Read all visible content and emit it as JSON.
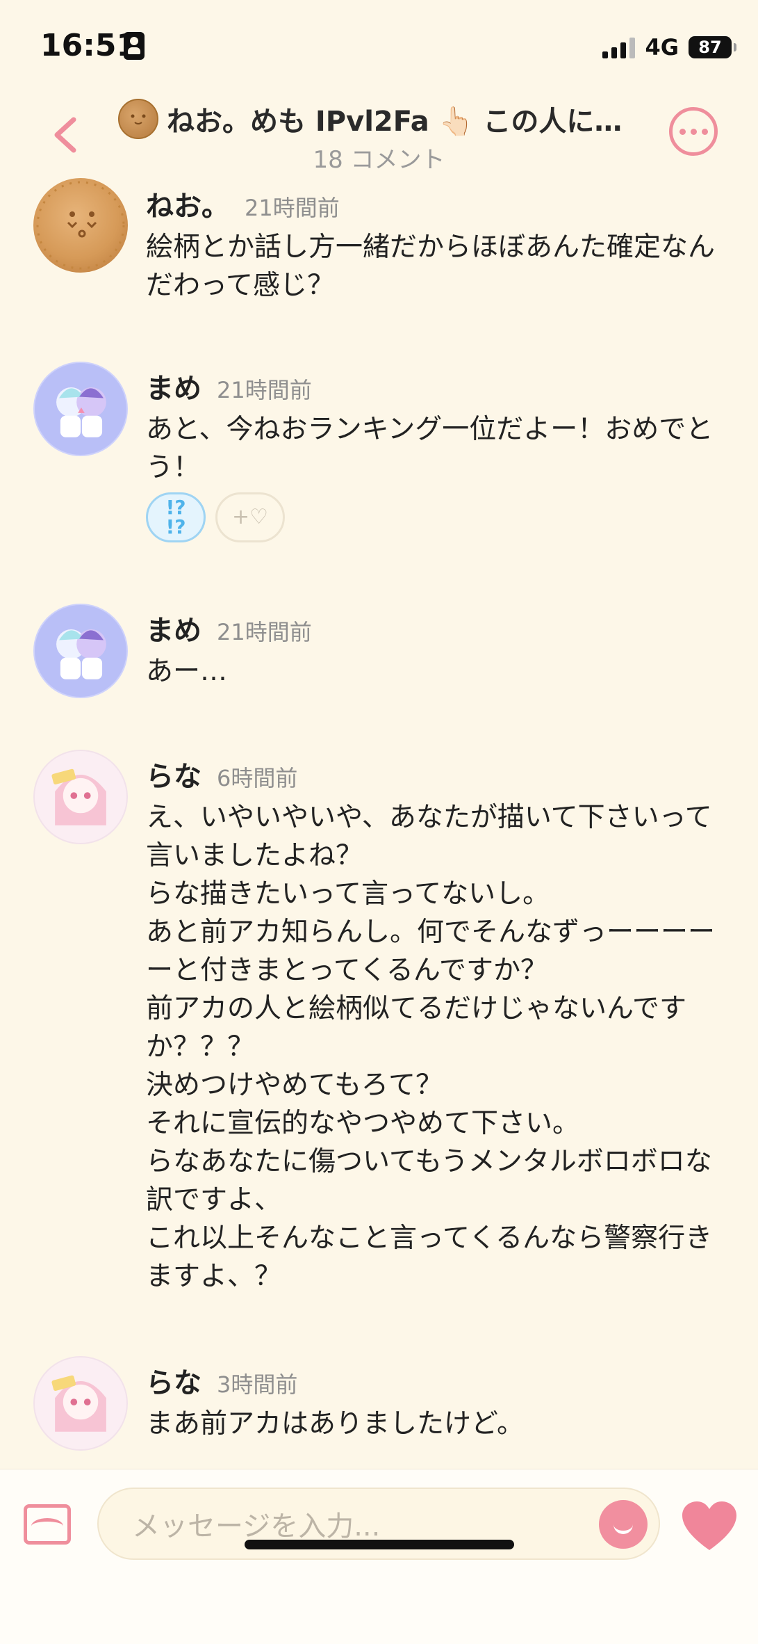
{
  "status_bar": {
    "time": "16:51",
    "network": "4G",
    "battery": "87"
  },
  "header": {
    "title": "ねお。めも IPvl2Fa 👆🏻 この人に…",
    "subtitle": "18 コメント",
    "back_icon": "chevron-left-icon",
    "more_icon": "ellipsis-icon"
  },
  "comments": [
    {
      "user": "ねお。",
      "time": "21時間前",
      "text": "絵柄とか話し方一緒だからほぼあんた確定なんだわって感じ？",
      "avatar": "cookie"
    },
    {
      "user": "まめ",
      "time": "21時間前",
      "text": "あと、今ねおランキング一位だよー！おめでとう！",
      "avatar": "mame",
      "reactions": {
        "active": "!?\n!?",
        "add": "+♡"
      }
    },
    {
      "user": "まめ",
      "time": "21時間前",
      "text": "あー…",
      "avatar": "mame"
    },
    {
      "user": "らな",
      "time": "6時間前",
      "text": "え、いやいやいや、あなたが描いて下さいって言いましたよね？\nらな描きたいって言ってないし。\nあと前アカ知らんし。何でそんなずっーーーーーと付きまとってくるんですか？\n前アカの人と絵柄似てるだけじゃないんですか？？？\n決めつけやめてもろて？\nそれに宣伝的なやつやめて下さい。\nらなあなたに傷ついてもうメンタルボロボロな訳ですよ、\nこれ以上そんなこと言ってくるんなら警察行きますよ、？",
      "avatar": "rana"
    },
    {
      "user": "らな",
      "time": "3時間前",
      "text": "まあ前アカはありましたけど。",
      "avatar": "rana"
    }
  ],
  "input_bar": {
    "placeholder": "メッセージを入力...",
    "image_icon": "image-icon",
    "emoji_icon": "smile-icon",
    "heart_icon": "heart-icon"
  },
  "colors": {
    "background": "#fdf7e8",
    "accent": "#ef8e9c",
    "reaction_blue": "#4fb3ea"
  }
}
